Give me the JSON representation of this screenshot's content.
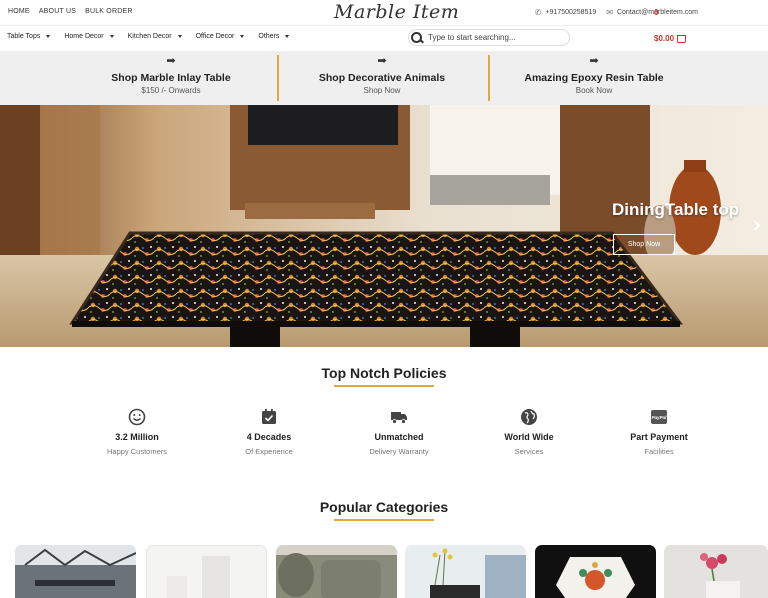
{
  "topbar": {
    "links": [
      "HOME",
      "ABOUT US",
      "BULK ORDER"
    ],
    "logo": "Marble Item",
    "phone": "+917500258519",
    "email": "Contact@marbleitem.com"
  },
  "nav": {
    "items": [
      "Table Tops",
      "Home Decor",
      "Kitchen Decor",
      "Office Decor",
      "Others"
    ],
    "search_placeholder": "Type to start searching...",
    "cart_total": "$0.00",
    "cart_count": "0"
  },
  "promos": [
    {
      "title": "Shop Marble Inlay Table",
      "subtitle": "$150 /- Onwards"
    },
    {
      "title": "Shop Decorative Animals",
      "subtitle": "Shop Now"
    },
    {
      "title": "Amazing Epoxy Resin Table",
      "subtitle": "Book Now"
    }
  ],
  "hero": {
    "caption": "DiningTable top",
    "button": "Shop Now"
  },
  "policies": {
    "heading": "Top Notch Policies",
    "items": [
      {
        "icon": "smiley-icon",
        "title": "3.2 Million",
        "subtitle": "Happy Customers"
      },
      {
        "icon": "calendar-check-icon",
        "title": "4 Decades",
        "subtitle": "Of Experience"
      },
      {
        "icon": "truck-icon",
        "title": "Unmatched",
        "subtitle": "Delivery Warranty"
      },
      {
        "icon": "globe-icon",
        "title": "World Wide",
        "subtitle": "Services"
      },
      {
        "icon": "paypal-icon",
        "title": "Part Payment",
        "subtitle": "Facilities"
      }
    ]
  },
  "categories": {
    "heading": "Popular Categories"
  },
  "colors": {
    "accent": "#e0a83b",
    "cart": "#c0392b",
    "promo_bg": "#efefef"
  }
}
